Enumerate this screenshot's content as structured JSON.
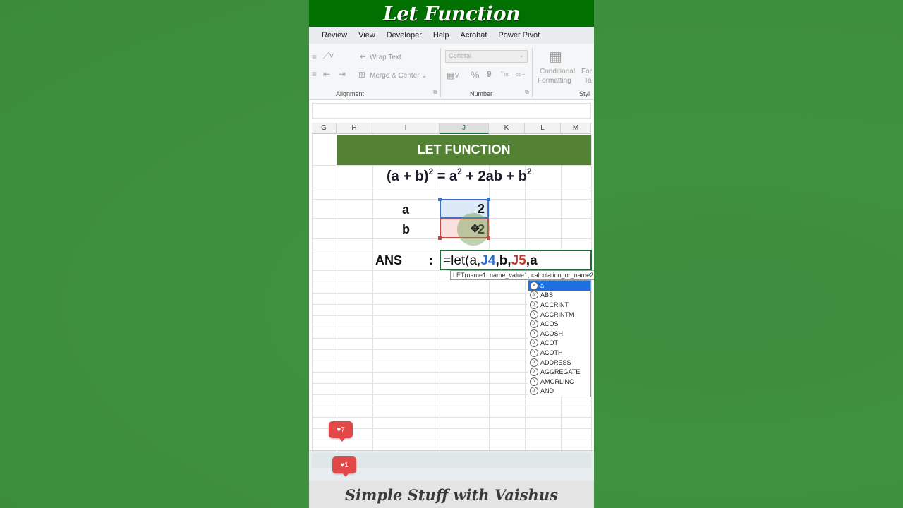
{
  "title": "Let Function",
  "menu": [
    "Review",
    "View",
    "Developer",
    "Help",
    "Acrobat",
    "Power Pivot"
  ],
  "ribbon": {
    "wrap_text": "Wrap Text",
    "merge_center": "Merge & Center",
    "number_format": "General",
    "percent": "%",
    "comma": "9",
    "conditional_formatting_line1": "Conditional",
    "conditional_formatting_line2": "Formatting",
    "format_table_line1": "For",
    "format_table_line2": "Ta",
    "alignment_label": "Alignment",
    "number_label": "Number",
    "styles_label": "Styl"
  },
  "columns": [
    "G",
    "H",
    "I",
    "J",
    "K",
    "L",
    "M"
  ],
  "active_column": "J",
  "sheet": {
    "banner": "LET FUNCTION",
    "label_a": "a",
    "label_b": "b",
    "value_a": "2",
    "value_b": "2",
    "ans_label": "ANS",
    "colon": ":",
    "formula_prefix": "=let(a,",
    "ref1": "J4",
    "mid": ",b,",
    "ref2": "J5",
    "suffix": ",a"
  },
  "tooltip": "LET(name1, name_value1, calculation_or_name2, ...)",
  "autocomplete": {
    "selected": "a",
    "items": [
      "ABS",
      "ACCRINT",
      "ACCRINTM",
      "ACOS",
      "ACOSH",
      "ACOT",
      "ACOTH",
      "ADDRESS",
      "AGGREGATE",
      "AMORLINC",
      "AND"
    ]
  },
  "likes": [
    "7",
    "1"
  ],
  "footer": "Simple Stuff with Vaishus",
  "colors": {
    "title_bar": "#007000",
    "banner": "#548235",
    "ref_blue": "#2f6bc8",
    "ref_red": "#c0392b",
    "like": "#e34848",
    "background": "#3e8c3e"
  }
}
